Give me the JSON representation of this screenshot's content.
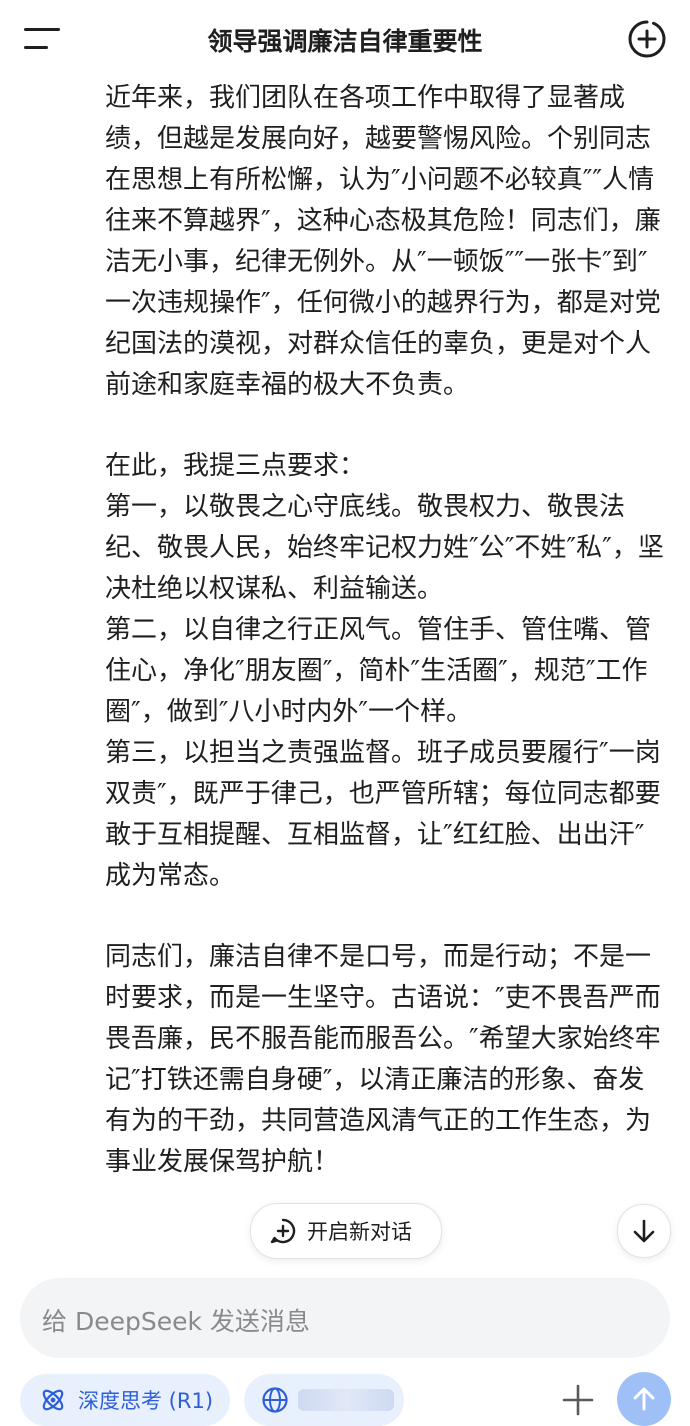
{
  "header": {
    "title": "领导强调廉洁自律重要性",
    "menu_icon": "hamburger-menu-icon",
    "new_chat_icon": "plus-circle-icon"
  },
  "message": {
    "paragraphs": [
      "近年来，我们团队在各项工作中取得了显著成绩，但越是发展向好，越要警惕风险。个别同志在思想上有所松懈，认为″小问题不必较真″″人情往来不算越界″，这种心态极其危险！同志们，廉洁无小事，纪律无例外。从″一顿饭″″一张卡″到″一次违规操作″，任何微小的越界行为，都是对党纪国法的漠视，对群众信任的辜负，更是对个人前途和家庭幸福的极大不负责。",
      "在此，我提三点要求：\n第一，以敬畏之心守底线。敬畏权力、敬畏法纪、敬畏人民，始终牢记权力姓″公″不姓″私″，坚决杜绝以权谋私、利益输送。\n第二，以自律之行正风气。管住手、管住嘴、管住心，净化″朋友圈″，简朴″生活圈″，规范″工作圈″，做到″八小时内外″一个样。\n第三，以担当之责强监督。班子成员要履行″一岗双责″，既严于律己，也严管所辖；每位同志都要敢于互相提醒、互相监督，让″红红脸、出出汗″成为常态。",
      "同志们，廉洁自律不是口号，而是行动；不是一时要求，而是一生坚守。古语说：″吏不畏吾严而畏吾廉，民不服吾能而服吾公。″希望大家始终牢记″打铁还需自身硬″，以清正廉洁的形象、奋发有为的干劲，共同营造风清气正的工作生态，为事业发展保驾护航！"
    ]
  },
  "floating": {
    "new_chat_label": "开启新对话",
    "new_chat_icon": "chat-plus-icon",
    "scroll_down_icon": "arrow-down-icon"
  },
  "composer": {
    "placeholder": "给 DeepSeek 发送消息",
    "deep_think_label": "深度思考 (R1)",
    "deep_think_icon": "atom-icon",
    "web_search_icon": "globe-icon",
    "attach_icon": "plus-icon",
    "send_icon": "arrow-up-icon"
  },
  "colors": {
    "accent": "#2e5fd8",
    "chip_bg": "#e8f0fd",
    "send_bg": "#9fbff7",
    "input_bg": "#f3f4f6"
  }
}
